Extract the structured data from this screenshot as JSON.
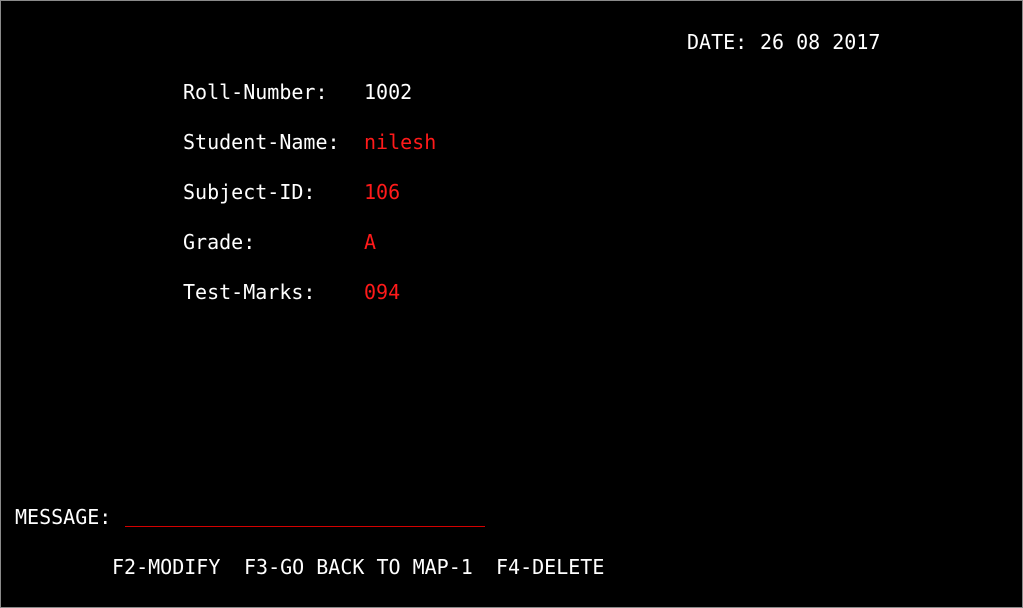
{
  "header": {
    "date_label": "DATE:",
    "date_value": "26 08 2017"
  },
  "fields": [
    {
      "label": "Roll-Number:",
      "value": "1002"
    },
    {
      "label": "Student-Name:",
      "value": "nilesh"
    },
    {
      "label": "Subject-ID:",
      "value": "106"
    },
    {
      "label": "Grade:",
      "value": "A"
    },
    {
      "label": "Test-Marks:",
      "value": "094"
    }
  ],
  "message": {
    "label": "MESSAGE:",
    "value": ""
  },
  "function_keys": [
    {
      "label": "F2-MODIFY"
    },
    {
      "label": "F3-GO BACK TO MAP-1"
    },
    {
      "label": "F4-DELETE"
    }
  ],
  "colors": {
    "background": "#000000",
    "label": "#ffffff",
    "input_value": "#ff1a1a",
    "underline": "#d40000"
  }
}
